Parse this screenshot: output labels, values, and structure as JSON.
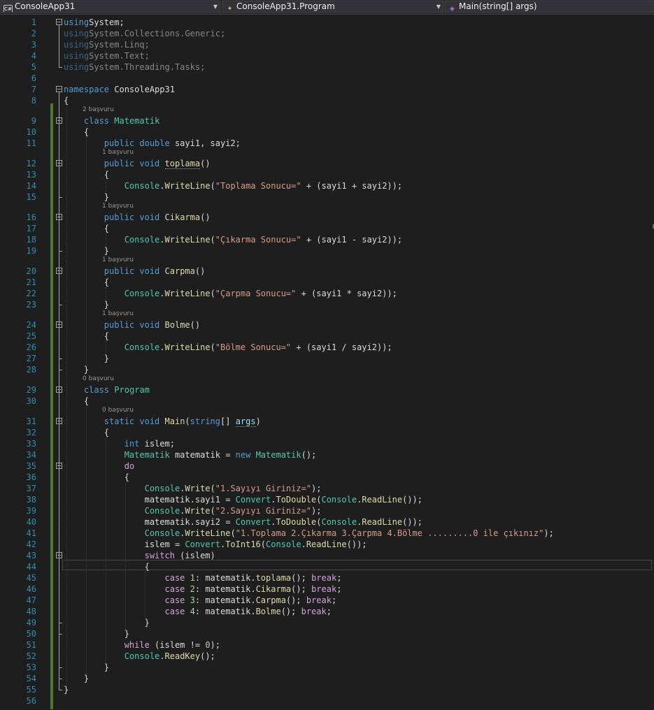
{
  "navbar": {
    "project": {
      "label": "ConsoleApp31",
      "icon": "csharp-project-icon"
    },
    "type": {
      "label": "ConsoleApp31.Program",
      "icon": "class-icon"
    },
    "member": {
      "label": "Main(string[] args)",
      "icon": "method-icon"
    }
  },
  "editor": {
    "language": "C#",
    "colors": {
      "background": "#1e1e1e",
      "keyword": "#569cd6",
      "type": "#4ec9b0",
      "string": "#d69d85",
      "control": "#d8a0df",
      "line_number": "#2b91af",
      "change_bar": "#4f7a28"
    },
    "current_line": 44,
    "references": [
      {
        "before_line": 9,
        "text": "2 başvuru"
      },
      {
        "before_line": 12,
        "text": "1 başvuru"
      },
      {
        "before_line": 16,
        "text": "1 başvuru"
      },
      {
        "before_line": 20,
        "text": "1 başvuru"
      },
      {
        "before_line": 24,
        "text": "1 başvuru"
      },
      {
        "before_line": 29,
        "text": "0 başvuru"
      },
      {
        "before_line": 31,
        "text": "0 başvuru"
      }
    ],
    "lines": [
      {
        "n": "1",
        "s": [
          [
            "kw",
            "using"
          ],
          [
            "",
            "System;"
          ]
        ]
      },
      {
        "n": "2",
        "s": [
          [
            "kw dim",
            "using"
          ],
          [
            "dim",
            "System.Collections.Generic;"
          ]
        ]
      },
      {
        "n": "3",
        "s": [
          [
            "kw dim",
            "using"
          ],
          [
            "dim",
            "System.Linq;"
          ]
        ]
      },
      {
        "n": "4",
        "s": [
          [
            "kw dim",
            "using"
          ],
          [
            "dim",
            "System.Text;"
          ]
        ]
      },
      {
        "n": "5",
        "s": [
          [
            "kw dim",
            "using"
          ],
          [
            "dim",
            "System.Threading.Tasks;"
          ]
        ]
      },
      {
        "n": "6",
        "s": []
      },
      {
        "n": "7",
        "s": [
          [
            "kw",
            "namespace"
          ],
          [
            "",
            " ConsoleApp31"
          ]
        ]
      },
      {
        "n": "8",
        "s": [
          [
            "",
            "{"
          ]
        ]
      },
      {
        "n": "9",
        "s": [
          [
            "",
            "    "
          ],
          [
            "kw",
            "class"
          ],
          [
            "",
            " "
          ],
          [
            "ty",
            "Matematik"
          ]
        ]
      },
      {
        "n": "10",
        "s": [
          [
            "",
            "    {"
          ]
        ]
      },
      {
        "n": "11",
        "s": [
          [
            "",
            "        "
          ],
          [
            "kw",
            "public double"
          ],
          [
            "",
            " sayi1, sayi2;"
          ]
        ]
      },
      {
        "n": "12",
        "s": [
          [
            "",
            "        "
          ],
          [
            "kw",
            "public void"
          ],
          [
            "",
            " "
          ],
          [
            "mb ul",
            "toplama"
          ],
          [
            "",
            "()"
          ]
        ]
      },
      {
        "n": "13",
        "s": [
          [
            "",
            "        {"
          ]
        ]
      },
      {
        "n": "14",
        "s": [
          [
            "",
            "            "
          ],
          [
            "ty",
            "Console"
          ],
          [
            "",
            "."
          ],
          [
            "mb",
            "WriteLine"
          ],
          [
            "",
            "("
          ],
          [
            "st",
            "\"Toplama Sonucu=\""
          ],
          [
            "",
            " + (sayi1 + sayi2));"
          ]
        ]
      },
      {
        "n": "15",
        "s": [
          [
            "",
            "        }"
          ]
        ]
      },
      {
        "n": "16",
        "s": [
          [
            "",
            "        "
          ],
          [
            "kw",
            "public void"
          ],
          [
            "",
            " "
          ],
          [
            "mb",
            "Cikarma"
          ],
          [
            "",
            "()"
          ]
        ]
      },
      {
        "n": "17",
        "s": [
          [
            "",
            "        {"
          ]
        ]
      },
      {
        "n": "18",
        "s": [
          [
            "",
            "            "
          ],
          [
            "ty",
            "Console"
          ],
          [
            "",
            "."
          ],
          [
            "mb",
            "WriteLine"
          ],
          [
            "",
            "("
          ],
          [
            "st",
            "\"Çıkarma Sonucu=\""
          ],
          [
            "",
            " + (sayi1 - sayi2));"
          ]
        ]
      },
      {
        "n": "19",
        "s": [
          [
            "",
            "        }"
          ]
        ]
      },
      {
        "n": "20",
        "s": [
          [
            "",
            "        "
          ],
          [
            "kw",
            "public void"
          ],
          [
            "",
            " "
          ],
          [
            "mb",
            "Carpma"
          ],
          [
            "",
            "()"
          ]
        ]
      },
      {
        "n": "21",
        "s": [
          [
            "",
            "        {"
          ]
        ]
      },
      {
        "n": "22",
        "s": [
          [
            "",
            "            "
          ],
          [
            "ty",
            "Console"
          ],
          [
            "",
            "."
          ],
          [
            "mb",
            "WriteLine"
          ],
          [
            "",
            "("
          ],
          [
            "st",
            "\"Çarpma Sonucu=\""
          ],
          [
            "",
            " + (sayi1 * sayi2));"
          ]
        ]
      },
      {
        "n": "23",
        "s": [
          [
            "",
            "        }"
          ]
        ]
      },
      {
        "n": "24",
        "s": [
          [
            "",
            "        "
          ],
          [
            "kw",
            "public void"
          ],
          [
            "",
            " "
          ],
          [
            "mb",
            "Bolme"
          ],
          [
            "",
            "()"
          ]
        ]
      },
      {
        "n": "25",
        "s": [
          [
            "",
            "        {"
          ]
        ]
      },
      {
        "n": "26",
        "s": [
          [
            "",
            "            "
          ],
          [
            "ty",
            "Console"
          ],
          [
            "",
            "."
          ],
          [
            "mb",
            "WriteLine"
          ],
          [
            "",
            "("
          ],
          [
            "st",
            "\"Bölme Sonucu=\""
          ],
          [
            "",
            " + (sayi1 / sayi2));"
          ]
        ]
      },
      {
        "n": "27",
        "s": [
          [
            "",
            "        }"
          ]
        ]
      },
      {
        "n": "28",
        "s": [
          [
            "",
            "    }"
          ]
        ]
      },
      {
        "n": "29",
        "s": [
          [
            "",
            "    "
          ],
          [
            "kw",
            "class"
          ],
          [
            "",
            " "
          ],
          [
            "ty",
            "Program"
          ]
        ]
      },
      {
        "n": "30",
        "s": [
          [
            "",
            "    {"
          ]
        ]
      },
      {
        "n": "31",
        "s": [
          [
            "",
            "        "
          ],
          [
            "kw",
            "static void"
          ],
          [
            "",
            " "
          ],
          [
            "mb",
            "Main"
          ],
          [
            "",
            "("
          ],
          [
            "kw",
            "string"
          ],
          [
            "",
            "[] "
          ],
          [
            "vr ul",
            "args"
          ],
          [
            "",
            ")"
          ]
        ]
      },
      {
        "n": "32",
        "s": [
          [
            "",
            "        {"
          ]
        ]
      },
      {
        "n": "33",
        "s": [
          [
            "",
            "            "
          ],
          [
            "kw",
            "int"
          ],
          [
            "",
            " islem;"
          ]
        ]
      },
      {
        "n": "34",
        "s": [
          [
            "",
            "            "
          ],
          [
            "ty",
            "Matematik"
          ],
          [
            "",
            " matematik = "
          ],
          [
            "kw",
            "new"
          ],
          [
            "",
            " "
          ],
          [
            "ty",
            "Matematik"
          ],
          [
            "",
            "();"
          ]
        ]
      },
      {
        "n": "35",
        "s": [
          [
            "",
            "            "
          ],
          [
            "ctl",
            "do"
          ]
        ]
      },
      {
        "n": "36",
        "s": [
          [
            "",
            "            {"
          ]
        ]
      },
      {
        "n": "37",
        "s": [
          [
            "",
            "                "
          ],
          [
            "ty",
            "Console"
          ],
          [
            "",
            "."
          ],
          [
            "mb",
            "Write"
          ],
          [
            "",
            "("
          ],
          [
            "st",
            "\"1.Sayıyı Giriniz=\""
          ],
          [
            "",
            ");"
          ]
        ]
      },
      {
        "n": "38",
        "s": [
          [
            "",
            "                matematik.sayi1 = "
          ],
          [
            "ty",
            "Convert"
          ],
          [
            "",
            "."
          ],
          [
            "mb",
            "ToDouble"
          ],
          [
            "",
            "("
          ],
          [
            "ty",
            "Console"
          ],
          [
            "",
            "."
          ],
          [
            "mb",
            "ReadLine"
          ],
          [
            "",
            "());"
          ]
        ]
      },
      {
        "n": "39",
        "s": [
          [
            "",
            "                "
          ],
          [
            "ty",
            "Console"
          ],
          [
            "",
            "."
          ],
          [
            "mb",
            "Write"
          ],
          [
            "",
            "("
          ],
          [
            "st",
            "\"2.Sayıyı Giriniz=\""
          ],
          [
            "",
            ");"
          ]
        ]
      },
      {
        "n": "40",
        "s": [
          [
            "",
            "                matematik.sayi2 = "
          ],
          [
            "ty",
            "Convert"
          ],
          [
            "",
            "."
          ],
          [
            "mb",
            "ToDouble"
          ],
          [
            "",
            "("
          ],
          [
            "ty",
            "Console"
          ],
          [
            "",
            "."
          ],
          [
            "mb",
            "ReadLine"
          ],
          [
            "",
            "());"
          ]
        ]
      },
      {
        "n": "41",
        "s": [
          [
            "",
            "                "
          ],
          [
            "ty",
            "Console"
          ],
          [
            "",
            "."
          ],
          [
            "mb",
            "WriteLine"
          ],
          [
            "",
            "("
          ],
          [
            "st",
            "\"1.Toplama 2.Çıkarma 3.Çarpma 4.Bölme .........0 ile çıkınız\""
          ],
          [
            "",
            ");"
          ]
        ]
      },
      {
        "n": "42",
        "s": [
          [
            "",
            "                islem = "
          ],
          [
            "ty",
            "Convert"
          ],
          [
            "",
            "."
          ],
          [
            "mb",
            "ToInt16"
          ],
          [
            "",
            "("
          ],
          [
            "ty",
            "Console"
          ],
          [
            "",
            "."
          ],
          [
            "mb",
            "ReadLine"
          ],
          [
            "",
            "());"
          ]
        ]
      },
      {
        "n": "43",
        "s": [
          [
            "",
            "                "
          ],
          [
            "ctl",
            "switch"
          ],
          [
            "",
            " (islem)"
          ]
        ]
      },
      {
        "n": "44",
        "s": [
          [
            "",
            "                {"
          ]
        ]
      },
      {
        "n": "45",
        "s": [
          [
            "",
            "                    "
          ],
          [
            "ctl",
            "case"
          ],
          [
            "",
            " "
          ],
          [
            "num",
            "1"
          ],
          [
            "",
            ": matematik."
          ],
          [
            "mb",
            "toplama"
          ],
          [
            "",
            "(); "
          ],
          [
            "ctl",
            "break"
          ],
          [
            "",
            ";"
          ]
        ]
      },
      {
        "n": "46",
        "s": [
          [
            "",
            "                    "
          ],
          [
            "ctl",
            "case"
          ],
          [
            "",
            " "
          ],
          [
            "num",
            "2"
          ],
          [
            "",
            ": matematik."
          ],
          [
            "mb",
            "Cikarma"
          ],
          [
            "",
            "(); "
          ],
          [
            "ctl",
            "break"
          ],
          [
            "",
            ";"
          ]
        ]
      },
      {
        "n": "47",
        "s": [
          [
            "",
            "                    "
          ],
          [
            "ctl",
            "case"
          ],
          [
            "",
            " "
          ],
          [
            "num",
            "3"
          ],
          [
            "",
            ": matematik."
          ],
          [
            "mb",
            "Carpma"
          ],
          [
            "",
            "(); "
          ],
          [
            "ctl",
            "break"
          ],
          [
            "",
            ";"
          ]
        ]
      },
      {
        "n": "48",
        "s": [
          [
            "",
            "                    "
          ],
          [
            "ctl",
            "case"
          ],
          [
            "",
            " "
          ],
          [
            "num",
            "4"
          ],
          [
            "",
            ": matematik."
          ],
          [
            "mb",
            "Bolme"
          ],
          [
            "",
            "(); "
          ],
          [
            "ctl",
            "break"
          ],
          [
            "",
            ";"
          ]
        ]
      },
      {
        "n": "49",
        "s": [
          [
            "",
            "                }"
          ]
        ]
      },
      {
        "n": "50",
        "s": [
          [
            "",
            "            }"
          ]
        ]
      },
      {
        "n": "51",
        "s": [
          [
            "",
            "            "
          ],
          [
            "ctl",
            "while"
          ],
          [
            "",
            " (islem != "
          ],
          [
            "num",
            "0"
          ],
          [
            "",
            ");"
          ]
        ]
      },
      {
        "n": "52",
        "s": [
          [
            "",
            "            "
          ],
          [
            "ty",
            "Console"
          ],
          [
            "",
            "."
          ],
          [
            "mb",
            "ReadKey"
          ],
          [
            "",
            "();"
          ]
        ]
      },
      {
        "n": "53",
        "s": [
          [
            "",
            "        }"
          ]
        ]
      },
      {
        "n": "54",
        "s": [
          [
            "",
            "    }"
          ]
        ]
      },
      {
        "n": "55",
        "s": [
          [
            "",
            "}"
          ]
        ]
      },
      {
        "n": "56",
        "s": []
      }
    ]
  }
}
